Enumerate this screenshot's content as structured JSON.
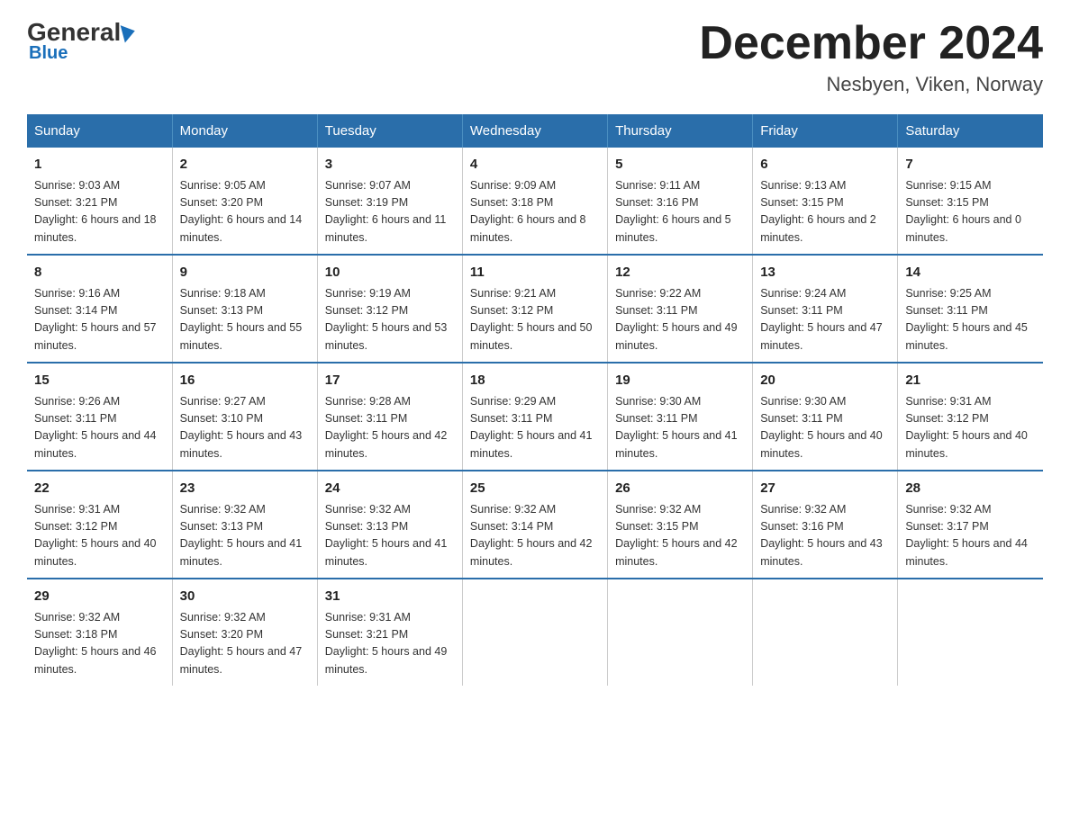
{
  "logo": {
    "general": "General",
    "blue": "Blue"
  },
  "title": "December 2024",
  "subtitle": "Nesbyen, Viken, Norway",
  "weekdays": [
    "Sunday",
    "Monday",
    "Tuesday",
    "Wednesday",
    "Thursday",
    "Friday",
    "Saturday"
  ],
  "weeks": [
    [
      {
        "day": "1",
        "sunrise": "9:03 AM",
        "sunset": "3:21 PM",
        "daylight": "6 hours and 18 minutes."
      },
      {
        "day": "2",
        "sunrise": "9:05 AM",
        "sunset": "3:20 PM",
        "daylight": "6 hours and 14 minutes."
      },
      {
        "day": "3",
        "sunrise": "9:07 AM",
        "sunset": "3:19 PM",
        "daylight": "6 hours and 11 minutes."
      },
      {
        "day": "4",
        "sunrise": "9:09 AM",
        "sunset": "3:18 PM",
        "daylight": "6 hours and 8 minutes."
      },
      {
        "day": "5",
        "sunrise": "9:11 AM",
        "sunset": "3:16 PM",
        "daylight": "6 hours and 5 minutes."
      },
      {
        "day": "6",
        "sunrise": "9:13 AM",
        "sunset": "3:15 PM",
        "daylight": "6 hours and 2 minutes."
      },
      {
        "day": "7",
        "sunrise": "9:15 AM",
        "sunset": "3:15 PM",
        "daylight": "6 hours and 0 minutes."
      }
    ],
    [
      {
        "day": "8",
        "sunrise": "9:16 AM",
        "sunset": "3:14 PM",
        "daylight": "5 hours and 57 minutes."
      },
      {
        "day": "9",
        "sunrise": "9:18 AM",
        "sunset": "3:13 PM",
        "daylight": "5 hours and 55 minutes."
      },
      {
        "day": "10",
        "sunrise": "9:19 AM",
        "sunset": "3:12 PM",
        "daylight": "5 hours and 53 minutes."
      },
      {
        "day": "11",
        "sunrise": "9:21 AM",
        "sunset": "3:12 PM",
        "daylight": "5 hours and 50 minutes."
      },
      {
        "day": "12",
        "sunrise": "9:22 AM",
        "sunset": "3:11 PM",
        "daylight": "5 hours and 49 minutes."
      },
      {
        "day": "13",
        "sunrise": "9:24 AM",
        "sunset": "3:11 PM",
        "daylight": "5 hours and 47 minutes."
      },
      {
        "day": "14",
        "sunrise": "9:25 AM",
        "sunset": "3:11 PM",
        "daylight": "5 hours and 45 minutes."
      }
    ],
    [
      {
        "day": "15",
        "sunrise": "9:26 AM",
        "sunset": "3:11 PM",
        "daylight": "5 hours and 44 minutes."
      },
      {
        "day": "16",
        "sunrise": "9:27 AM",
        "sunset": "3:10 PM",
        "daylight": "5 hours and 43 minutes."
      },
      {
        "day": "17",
        "sunrise": "9:28 AM",
        "sunset": "3:11 PM",
        "daylight": "5 hours and 42 minutes."
      },
      {
        "day": "18",
        "sunrise": "9:29 AM",
        "sunset": "3:11 PM",
        "daylight": "5 hours and 41 minutes."
      },
      {
        "day": "19",
        "sunrise": "9:30 AM",
        "sunset": "3:11 PM",
        "daylight": "5 hours and 41 minutes."
      },
      {
        "day": "20",
        "sunrise": "9:30 AM",
        "sunset": "3:11 PM",
        "daylight": "5 hours and 40 minutes."
      },
      {
        "day": "21",
        "sunrise": "9:31 AM",
        "sunset": "3:12 PM",
        "daylight": "5 hours and 40 minutes."
      }
    ],
    [
      {
        "day": "22",
        "sunrise": "9:31 AM",
        "sunset": "3:12 PM",
        "daylight": "5 hours and 40 minutes."
      },
      {
        "day": "23",
        "sunrise": "9:32 AM",
        "sunset": "3:13 PM",
        "daylight": "5 hours and 41 minutes."
      },
      {
        "day": "24",
        "sunrise": "9:32 AM",
        "sunset": "3:13 PM",
        "daylight": "5 hours and 41 minutes."
      },
      {
        "day": "25",
        "sunrise": "9:32 AM",
        "sunset": "3:14 PM",
        "daylight": "5 hours and 42 minutes."
      },
      {
        "day": "26",
        "sunrise": "9:32 AM",
        "sunset": "3:15 PM",
        "daylight": "5 hours and 42 minutes."
      },
      {
        "day": "27",
        "sunrise": "9:32 AM",
        "sunset": "3:16 PM",
        "daylight": "5 hours and 43 minutes."
      },
      {
        "day": "28",
        "sunrise": "9:32 AM",
        "sunset": "3:17 PM",
        "daylight": "5 hours and 44 minutes."
      }
    ],
    [
      {
        "day": "29",
        "sunrise": "9:32 AM",
        "sunset": "3:18 PM",
        "daylight": "5 hours and 46 minutes."
      },
      {
        "day": "30",
        "sunrise": "9:32 AM",
        "sunset": "3:20 PM",
        "daylight": "5 hours and 47 minutes."
      },
      {
        "day": "31",
        "sunrise": "9:31 AM",
        "sunset": "3:21 PM",
        "daylight": "5 hours and 49 minutes."
      },
      null,
      null,
      null,
      null
    ]
  ]
}
